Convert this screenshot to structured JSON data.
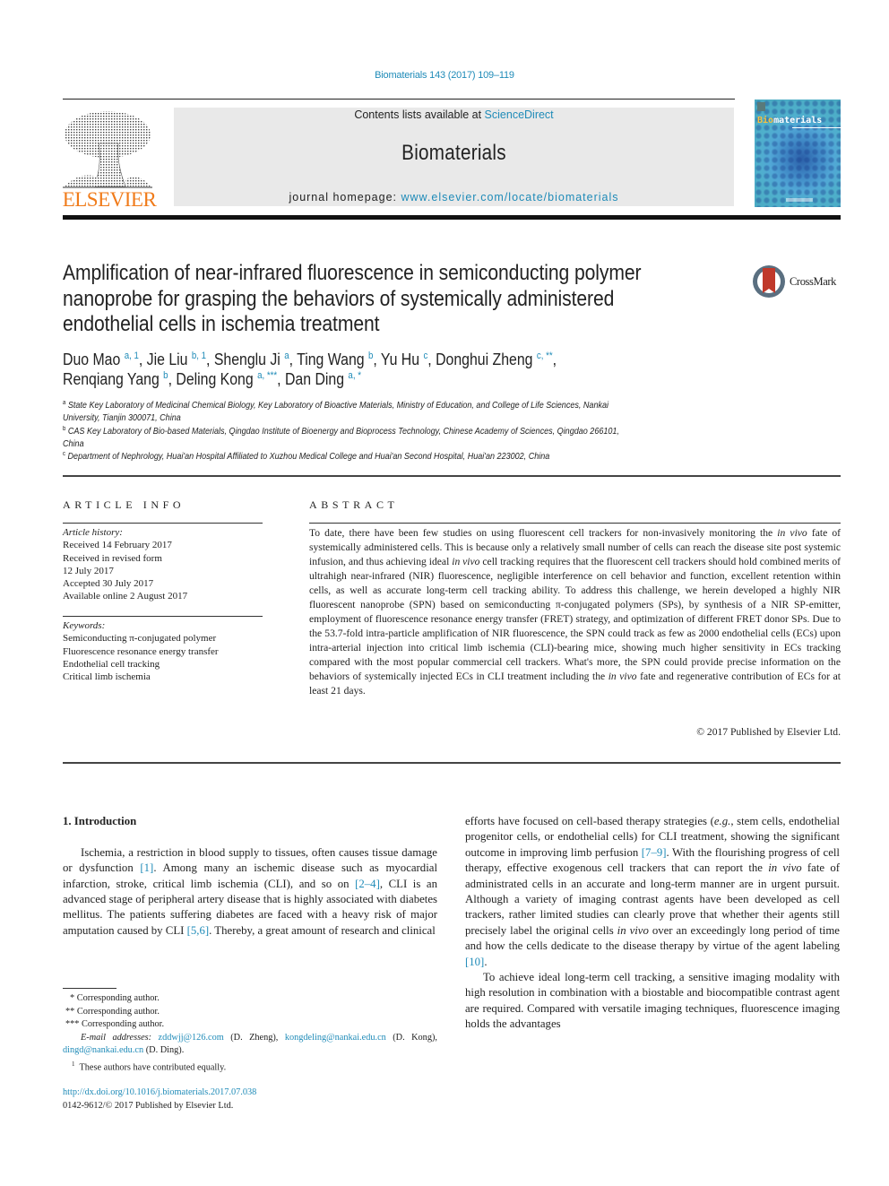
{
  "header": {
    "journal_ref": "Biomaterials 143 (2017) 109–119",
    "contents_prefix": "Contents lists available at ",
    "contents_link": "ScienceDirect",
    "journal_name": "Biomaterials",
    "homepage_prefix": "journal homepage: ",
    "homepage_link": "www.elsevier.com/locate/biomaterials",
    "publisher_logo": "ELSEVIER",
    "cover_title_a": "Bio",
    "cover_title_b": "materials",
    "colors": {
      "link": "#1f8bb8",
      "elsevier_orange": "#f07b1a",
      "banner_bg": "#e9e9e9"
    }
  },
  "article": {
    "title": "Amplification of near-infrared fluorescence in semiconducting polymer nanoprobe for grasping the behaviors of systemically administered endothelial cells in ischemia treatment",
    "crossmark_label": "CrossMark",
    "authors": [
      {
        "name": "Duo Mao",
        "sup": "a, 1",
        "sep": ", "
      },
      {
        "name": "Jie Liu",
        "sup": "b, 1",
        "sep": ", "
      },
      {
        "name": "Shenglu Ji",
        "sup": "a",
        "sep": ", "
      },
      {
        "name": "Ting Wang",
        "sup": "b",
        "sep": ", "
      },
      {
        "name": "Yu Hu",
        "sup": "c",
        "sep": ", "
      },
      {
        "name": "Donghui Zheng",
        "sup": "c, **",
        "sep": ","
      },
      {
        "name": "Renqiang Yang",
        "sup": "b",
        "sep": ", "
      },
      {
        "name": "Deling Kong",
        "sup": "a, ***",
        "sep": ", "
      },
      {
        "name": "Dan Ding",
        "sup": "a, *",
        "sep": ""
      }
    ],
    "affiliations": [
      {
        "key": "a",
        "text": "State Key Laboratory of Medicinal Chemical Biology, Key Laboratory of Bioactive Materials, Ministry of Education, and College of Life Sciences, Nankai",
        "text2": "University, Tianjin 300071, China"
      },
      {
        "key": "b",
        "text": "CAS Key Laboratory of Bio-based Materials, Qingdao Institute of Bioenergy and Bioprocess Technology, Chinese Academy of Sciences, Qingdao 266101,",
        "text2": "China"
      },
      {
        "key": "c",
        "text": "Department of Nephrology, Huai'an Hospital Affiliated to Xuzhou Medical College and Huai'an Second Hospital, Huai'an 223002, China",
        "text2": ""
      }
    ]
  },
  "article_info": {
    "heading": "ARTICLE INFO",
    "history_label": "Article history:",
    "history": [
      "Received 14 February 2017",
      "Received in revised form",
      "12 July 2017",
      "Accepted 30 July 2017",
      "Available online 2 August 2017"
    ],
    "keywords_label": "Keywords:",
    "keywords": [
      "Semiconducting π-conjugated polymer",
      "Fluorescence resonance energy transfer",
      "Endothelial cell tracking",
      "Critical limb ischemia"
    ]
  },
  "abstract": {
    "heading": "ABSTRACT",
    "p1": "To date, there have been few studies on using fluorescent cell trackers for non-invasively monitoring the ",
    "i1": "in vivo",
    "p2": " fate of systemically administered cells. This is because only a relatively small number of cells can reach the disease site post systemic infusion, and thus achieving ideal ",
    "i2": "in vivo",
    "p3": " cell tracking requires that the fluorescent cell trackers should hold combined merits of ultrahigh near-infrared (NIR) fluorescence, negligible interference on cell behavior and function, excellent retention within cells, as well as accurate long-term cell tracking ability. To address this challenge, we herein developed a highly NIR fluorescent nanoprobe (SPN) based on semiconducting π-conjugated polymers (SPs), by synthesis of a NIR SP-emitter, employment of fluorescence resonance energy transfer (FRET) strategy, and optimization of different FRET donor SPs. Due to the 53.7-fold intra-particle amplification of NIR fluorescence, the SPN could track as few as 2000 endothelial cells (ECs) upon intra-arterial injection into critical limb ischemia (CLI)-bearing mice, showing much higher sensitivity in ECs tracking compared with the most popular commercial cell trackers. What's more, the SPN could provide precise information on the behaviors of systemically injected ECs in CLI treatment including the ",
    "i3": "in vivo",
    "p4": " fate and regenerative contribution of ECs for at least 21 days.",
    "copyright": "© 2017 Published by Elsevier Ltd."
  },
  "body": {
    "section_heading": "1.  Introduction",
    "left": {
      "t1": "Ischemia, a restriction in blood supply to tissues, often causes tissue damage or dysfunction ",
      "r1": "[1]",
      "t2": ". Among many an ischemic disease such as myocardial infarction, stroke, critical limb ischemia (CLI), and so on ",
      "r2": "[2–4]",
      "t3": ", CLI is an advanced stage of peripheral artery disease that is highly associated with diabetes mellitus. The patients suffering diabetes are faced with a heavy risk of major amputation caused by CLI ",
      "r3": "[5,6]",
      "t4": ". Thereby, a great amount of research and clinical"
    },
    "right": {
      "t1": "efforts have focused on cell-based therapy strategies (",
      "i1": "e.g.",
      "t2": ", stem cells, endothelial progenitor cells, or endothelial cells) for CLI treatment, showing the significant outcome in improving limb perfusion ",
      "r1": "[7–9]",
      "t3": ". With the flourishing progress of cell therapy, effective exogenous cell trackers that can report the ",
      "i2": "in vivo",
      "t4": " fate of administrated cells in an accurate and long-term manner are in urgent pursuit. Although a variety of imaging contrast agents have been developed as cell trackers, rather limited studies can clearly prove that whether their agents still precisely label the original cells ",
      "i3": "in vivo",
      "t5": " over an exceedingly long period of time and how the cells dedicate to the disease therapy by virtue of the agent labeling ",
      "r2": "[10]",
      "t6": ".",
      "p2": "To achieve ideal long-term cell tracking, a sensitive imaging modality with high resolution in combination with a biostable and biocompatible contrast agent are required. Compared with versatile imaging techniques, fluorescence imaging holds the advantages"
    }
  },
  "footnotes": {
    "corr1": "* Corresponding author.",
    "corr2": "** Corresponding author.",
    "corr3": "*** Corresponding author.",
    "email_label": "E-mail addresses:",
    "email1": "zddwjj@126.com",
    "email1_who": " (D. Zheng), ",
    "email2": "kongdeling@nankai.edu.cn",
    "email2_who": " (D. Kong), ",
    "email3": "dingd@nankai.edu.cn",
    "email3_who": " (D. Ding).",
    "equal_sup": "1",
    "equal": "These authors have contributed equally.",
    "doi": "http://dx.doi.org/10.1016/j.biomaterials.2017.07.038",
    "issn": "0142-9612/© 2017 Published by Elsevier Ltd."
  }
}
